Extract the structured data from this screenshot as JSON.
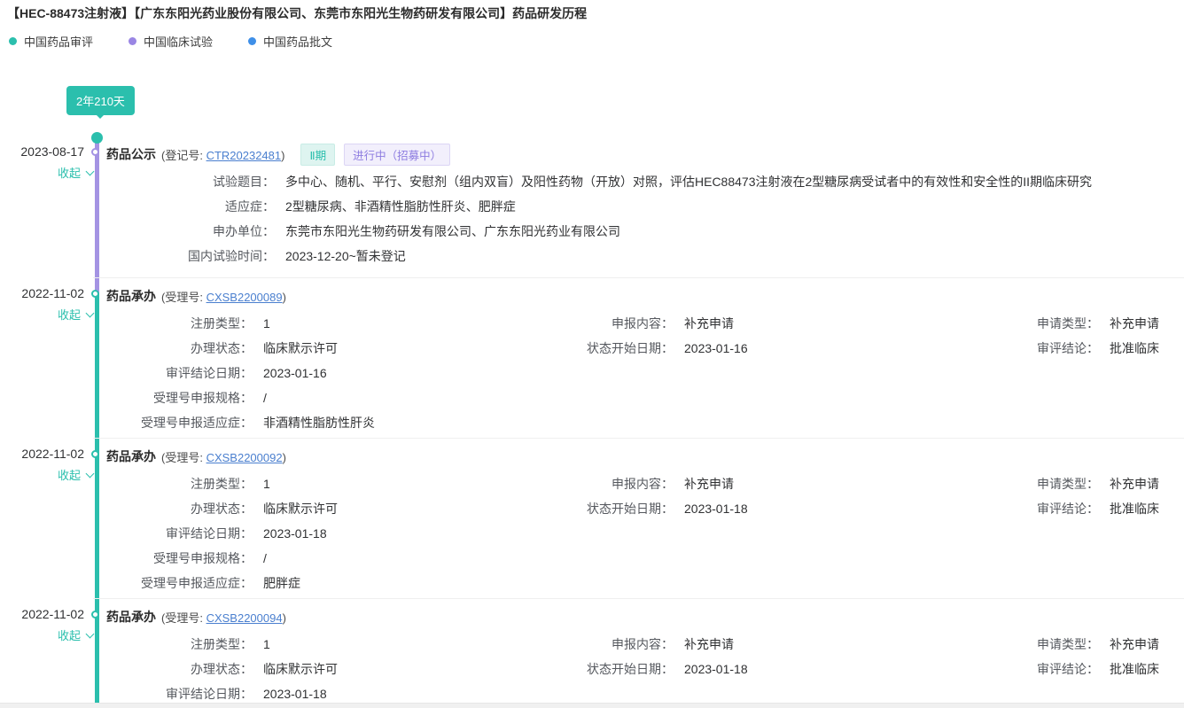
{
  "header": {
    "title": "【HEC-88473注射液】【广东东阳光药业股份有限公司、东莞市东阳光生物药研发有限公司】药品研发历程",
    "legend": [
      {
        "label": "中国药品审评",
        "color": "#2bbfad"
      },
      {
        "label": "中国临床试验",
        "color": "#9a86e4"
      },
      {
        "label": "中国药品批文",
        "color": "#3e8fe8"
      }
    ]
  },
  "timeline": {
    "duration_badge": "2年210天",
    "colors": {
      "review_teal": "#2bbfad",
      "clinical_purple": "#a493e3",
      "approval_blue": "#3e8fe8",
      "link_blue": "#4a7fcf"
    }
  },
  "entries": [
    {
      "date": "2023-08-17",
      "collapse": "收起",
      "title": "药品公示",
      "id_prefix": "(登记号: ",
      "id_link": "CTR20232481",
      "id_suffix": ")",
      "tags": {
        "phase": "Ⅱ期",
        "status": "进行中（招募中）"
      },
      "fields": [
        {
          "label": "试验题目：",
          "value": "多中心、随机、平行、安慰剂（组内双盲）及阳性药物（开放）对照，评估HEC88473注射液在2型糖尿病受试者中的有效性和安全性的II期临床研究"
        },
        {
          "label": "适应症：",
          "value": "2型糖尿病、非酒精性脂肪性肝炎、肥胖症"
        },
        {
          "label": "申办单位：",
          "value": "东莞市东阳光生物药研发有限公司、广东东阳光药业有限公司"
        },
        {
          "label": "国内试验时间：",
          "value": "2023-12-20~暂未登记"
        }
      ]
    },
    {
      "date": "2022-11-02",
      "collapse": "收起",
      "title": "药品承办",
      "id_prefix": "(受理号: ",
      "id_link": "CXSB2200089",
      "id_suffix": ")",
      "rows": [
        {
          "c1l": "注册类型：",
          "c1v": "1",
          "c2l": "申报内容：",
          "c2v": "补充申请",
          "c3l": "申请类型：",
          "c3v": "补充申请"
        },
        {
          "c1l": "办理状态：",
          "c1v": "临床默示许可",
          "c2l": "状态开始日期：",
          "c2v": "2023-01-16",
          "c3l": "审评结论：",
          "c3v": "批准临床"
        },
        {
          "c1l": "审评结论日期：",
          "c1v": "2023-01-16"
        },
        {
          "c1l": "受理号申报规格：",
          "c1v": "/"
        },
        {
          "c1l": "受理号申报适应症：",
          "c1v": "非酒精性脂肪性肝炎"
        }
      ]
    },
    {
      "date": "2022-11-02",
      "collapse": "收起",
      "title": "药品承办",
      "id_prefix": "(受理号: ",
      "id_link": "CXSB2200092",
      "id_suffix": ")",
      "rows": [
        {
          "c1l": "注册类型：",
          "c1v": "1",
          "c2l": "申报内容：",
          "c2v": "补充申请",
          "c3l": "申请类型：",
          "c3v": "补充申请"
        },
        {
          "c1l": "办理状态：",
          "c1v": "临床默示许可",
          "c2l": "状态开始日期：",
          "c2v": "2023-01-18",
          "c3l": "审评结论：",
          "c3v": "批准临床"
        },
        {
          "c1l": "审评结论日期：",
          "c1v": "2023-01-18"
        },
        {
          "c1l": "受理号申报规格：",
          "c1v": "/"
        },
        {
          "c1l": "受理号申报适应症：",
          "c1v": "肥胖症"
        }
      ]
    },
    {
      "date": "2022-11-02",
      "collapse": "收起",
      "title": "药品承办",
      "id_prefix": "(受理号: ",
      "id_link": "CXSB2200094",
      "id_suffix": ")",
      "rows": [
        {
          "c1l": "注册类型：",
          "c1v": "1",
          "c2l": "申报内容：",
          "c2v": "补充申请",
          "c3l": "申请类型：",
          "c3v": "补充申请"
        },
        {
          "c1l": "办理状态：",
          "c1v": "临床默示许可",
          "c2l": "状态开始日期：",
          "c2v": "2023-01-18",
          "c3l": "审评结论：",
          "c3v": "批准临床"
        },
        {
          "c1l": "审评结论日期：",
          "c1v": "2023-01-18"
        }
      ]
    }
  ]
}
